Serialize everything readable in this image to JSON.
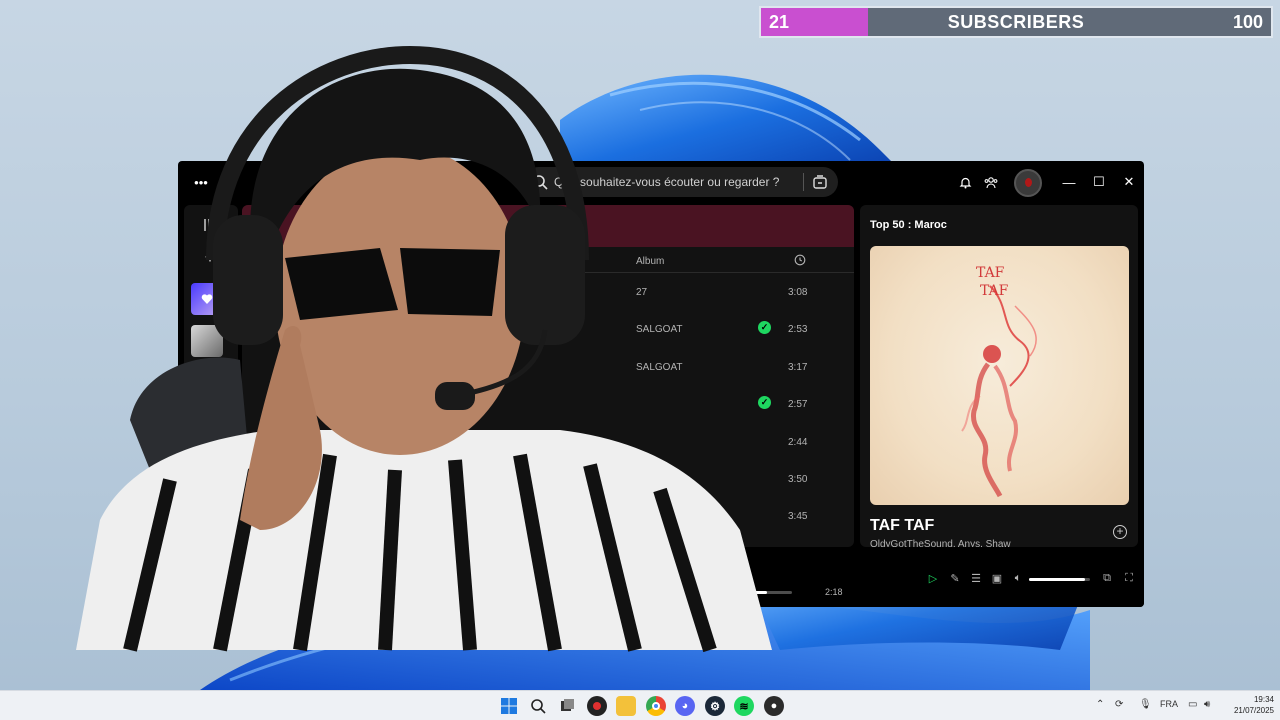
{
  "subscribers": {
    "current": "21",
    "label": "SUBSCRIBERS",
    "goal": "100",
    "progress_percent": 21,
    "fill_color": "#c94fd0"
  },
  "spotify": {
    "search": {
      "placeholder": "Que souhaitez-vous écouter ou regarder ?"
    },
    "table": {
      "album_header": "Album",
      "rows": [
        {
          "album": "27",
          "downloaded": false,
          "duration": "3:08"
        },
        {
          "album": "SALGOAT",
          "downloaded": true,
          "duration": "2:53"
        },
        {
          "album": "SALGOAT",
          "downloaded": false,
          "duration": "3:17"
        },
        {
          "album": "",
          "downloaded": true,
          "duration": "2:57"
        },
        {
          "album": "",
          "downloaded": false,
          "duration": "2:44"
        },
        {
          "album": "",
          "downloaded": false,
          "duration": "3:50"
        },
        {
          "album": "",
          "downloaded": false,
          "duration": "3:45"
        }
      ]
    },
    "now_playing": {
      "playlist": "Top 50 : Maroc",
      "cover_text_line1": "TAF",
      "cover_text_line2": "TAF",
      "title": "TAF TAF",
      "artists": "OldyGotTheSound, Anys, Shaw"
    },
    "player": {
      "total_time": "2:18",
      "progress_percent": 70,
      "volume_percent": 92
    },
    "accent_color": "#1ed760"
  },
  "taskbar": {
    "language": "FRA",
    "time": "19:34",
    "date": "21/07/2025",
    "apps": [
      "windows-start",
      "search",
      "task-view",
      "red-app",
      "file-explorer",
      "chrome",
      "discord",
      "steam",
      "spotify",
      "obs"
    ]
  }
}
